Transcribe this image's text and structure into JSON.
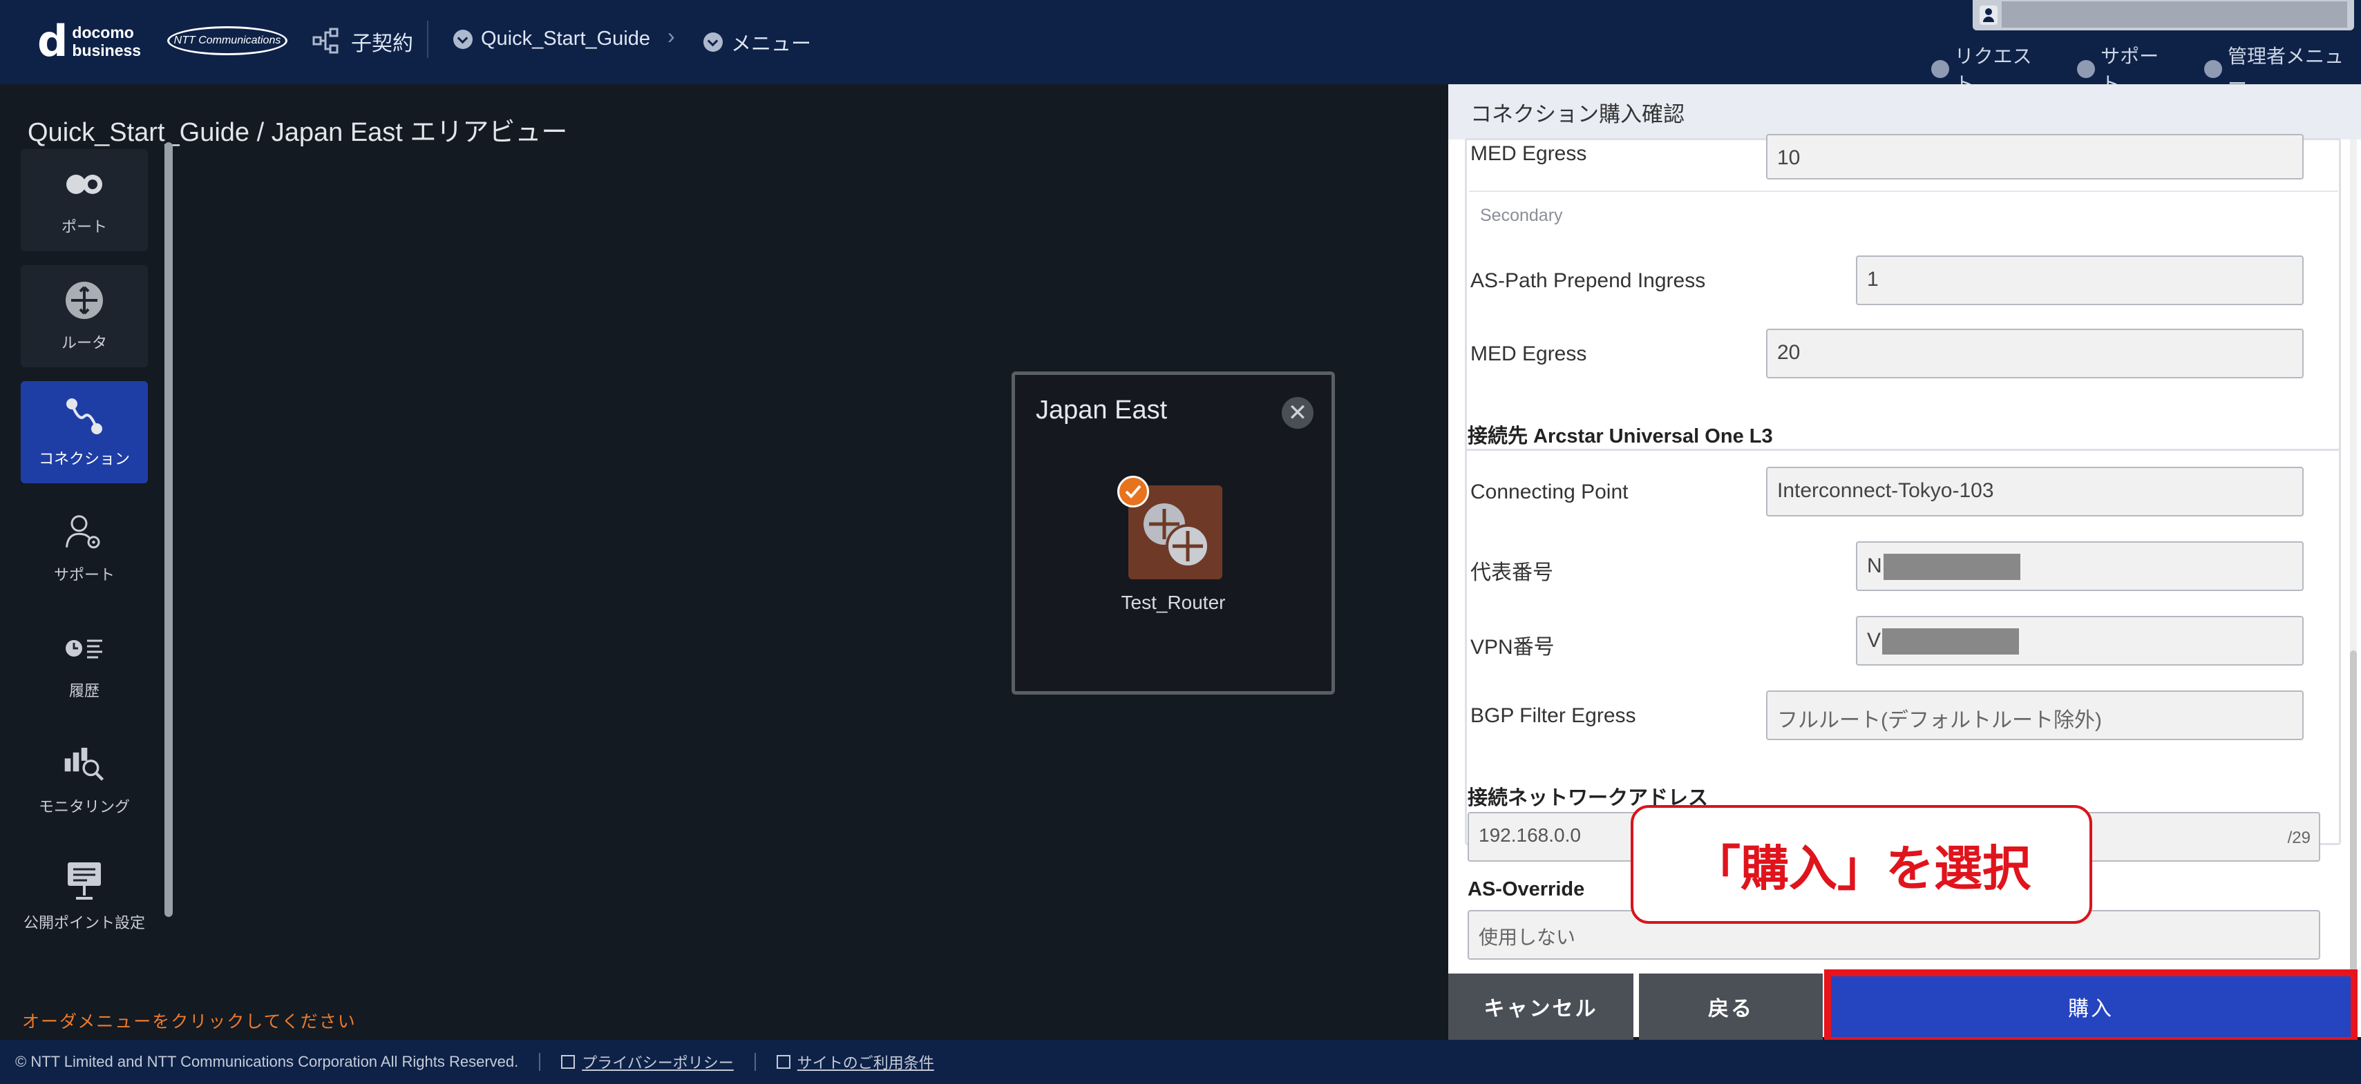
{
  "header": {
    "logo_mark": "d",
    "logo_line1": "docomo",
    "logo_line2": "business",
    "ntt_logo": "NTT Communications",
    "contract_label": "子契約",
    "breadcrumb_1": "Quick_Start_Guide",
    "breadcrumb_2": "メニュー",
    "links": {
      "request": "リクエスト",
      "support": "サポート",
      "admin_menu": "管理者メニュー"
    }
  },
  "page_title": "Quick_Start_Guide / Japan East エリアビュー",
  "sidebar": {
    "items": [
      {
        "label": "ポート",
        "icon": "port-icon"
      },
      {
        "label": "ルータ",
        "icon": "router-icon"
      },
      {
        "label": "コネクション",
        "icon": "connection-icon"
      },
      {
        "label": "サポート",
        "icon": "support-icon"
      },
      {
        "label": "履歴",
        "icon": "history-icon"
      },
      {
        "label": "モニタリング",
        "icon": "monitoring-icon"
      },
      {
        "label": "公開ポイント設定",
        "icon": "public-point-icon"
      }
    ],
    "order_hint": "オーダメニューをクリックしてください"
  },
  "map_popup": {
    "title": "Japan East",
    "close": "✕",
    "router_name": "Test_Router"
  },
  "panel": {
    "title": "コネクション購入確認",
    "primary_med_egress_label": "MED Egress",
    "primary_med_egress_value": "10",
    "secondary_label": "Secondary",
    "as_path_label": "AS-Path Prepend Ingress",
    "as_path_value": "1",
    "secondary_med_egress_label": "MED Egress",
    "secondary_med_egress_value": "20",
    "dest_title": "接続先 Arcstar Universal One L3",
    "connecting_point_label": "Connecting Point",
    "connecting_point_value": "Interconnect-Tokyo-103",
    "rep_number_label": "代表番号",
    "rep_number_prefix": "N",
    "vpn_number_label": "VPN番号",
    "vpn_number_prefix": "V",
    "bgp_filter_label": "BGP Filter Egress",
    "bgp_filter_value": "フルルート(デフォルトルート除外)",
    "network_address_title": "接続ネットワークアドレス",
    "network_address_value": "192.168.0.0",
    "network_prefix": "/29",
    "as_override_title": "AS-Override",
    "as_override_value": "使用しない"
  },
  "buttons": {
    "cancel": "キャンセル",
    "back": "戻る",
    "buy": "購入"
  },
  "callout": "「購入」を選択",
  "footer": {
    "copyright": "© NTT Limited and NTT Communications Corporation All Rights Reserved.",
    "privacy": "プライバシーポリシー",
    "terms": "サイトのご利用条件"
  },
  "colors": {
    "header_bg": "#0e2248",
    "primary_button": "#2544c0",
    "highlight_red": "#e8141c",
    "accent_orange": "#ef7b2b"
  }
}
